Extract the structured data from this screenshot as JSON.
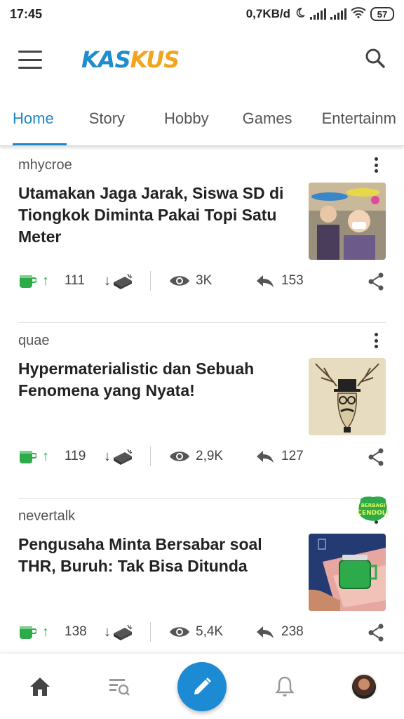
{
  "status_bar": {
    "time": "17:45",
    "network_speed": "0,7KB/d",
    "battery": "57"
  },
  "header": {
    "logo_part1": "KAS",
    "logo_part2": "KUS"
  },
  "tabs": [
    {
      "label": "Home",
      "active": true
    },
    {
      "label": "Story",
      "active": false
    },
    {
      "label": "Hobby",
      "active": false
    },
    {
      "label": "Games",
      "active": false
    },
    {
      "label": "Entertainm",
      "active": false
    }
  ],
  "posts": [
    {
      "author": "mhycroe",
      "title": "Utamakan Jaga Jarak, Siswa SD di Tiongkok Diminta Pakai Topi Satu Meter",
      "upvotes": "111",
      "views": "3K",
      "replies": "153",
      "thumbnail": "students-with-meter-hats"
    },
    {
      "author": "quae",
      "title": "Hypermaterialistic dan Sebuah Fenomena yang Nyata!",
      "upvotes": "119",
      "views": "2,9K",
      "replies": "127",
      "thumbnail": "deer-with-hat-sketch"
    },
    {
      "author": "nevertalk",
      "title": "Pengusaha Minta Bersabar soal THR, Buruh: Tak Bisa Ditunda",
      "upvotes": "138",
      "views": "5,4K",
      "replies": "238",
      "thumbnail": "money-and-cendol",
      "badge": "BERBAGI CENDOL!"
    }
  ],
  "colors": {
    "brand_blue": "#1f87c8",
    "brand_orange": "#f3a31c",
    "upvote_green": "#2dab4a",
    "fab_blue": "#1d8ad4"
  },
  "bottom_nav": {
    "items": [
      "home-icon",
      "search-list-icon",
      "compose-pencil-icon",
      "bell-icon",
      "avatar"
    ]
  }
}
